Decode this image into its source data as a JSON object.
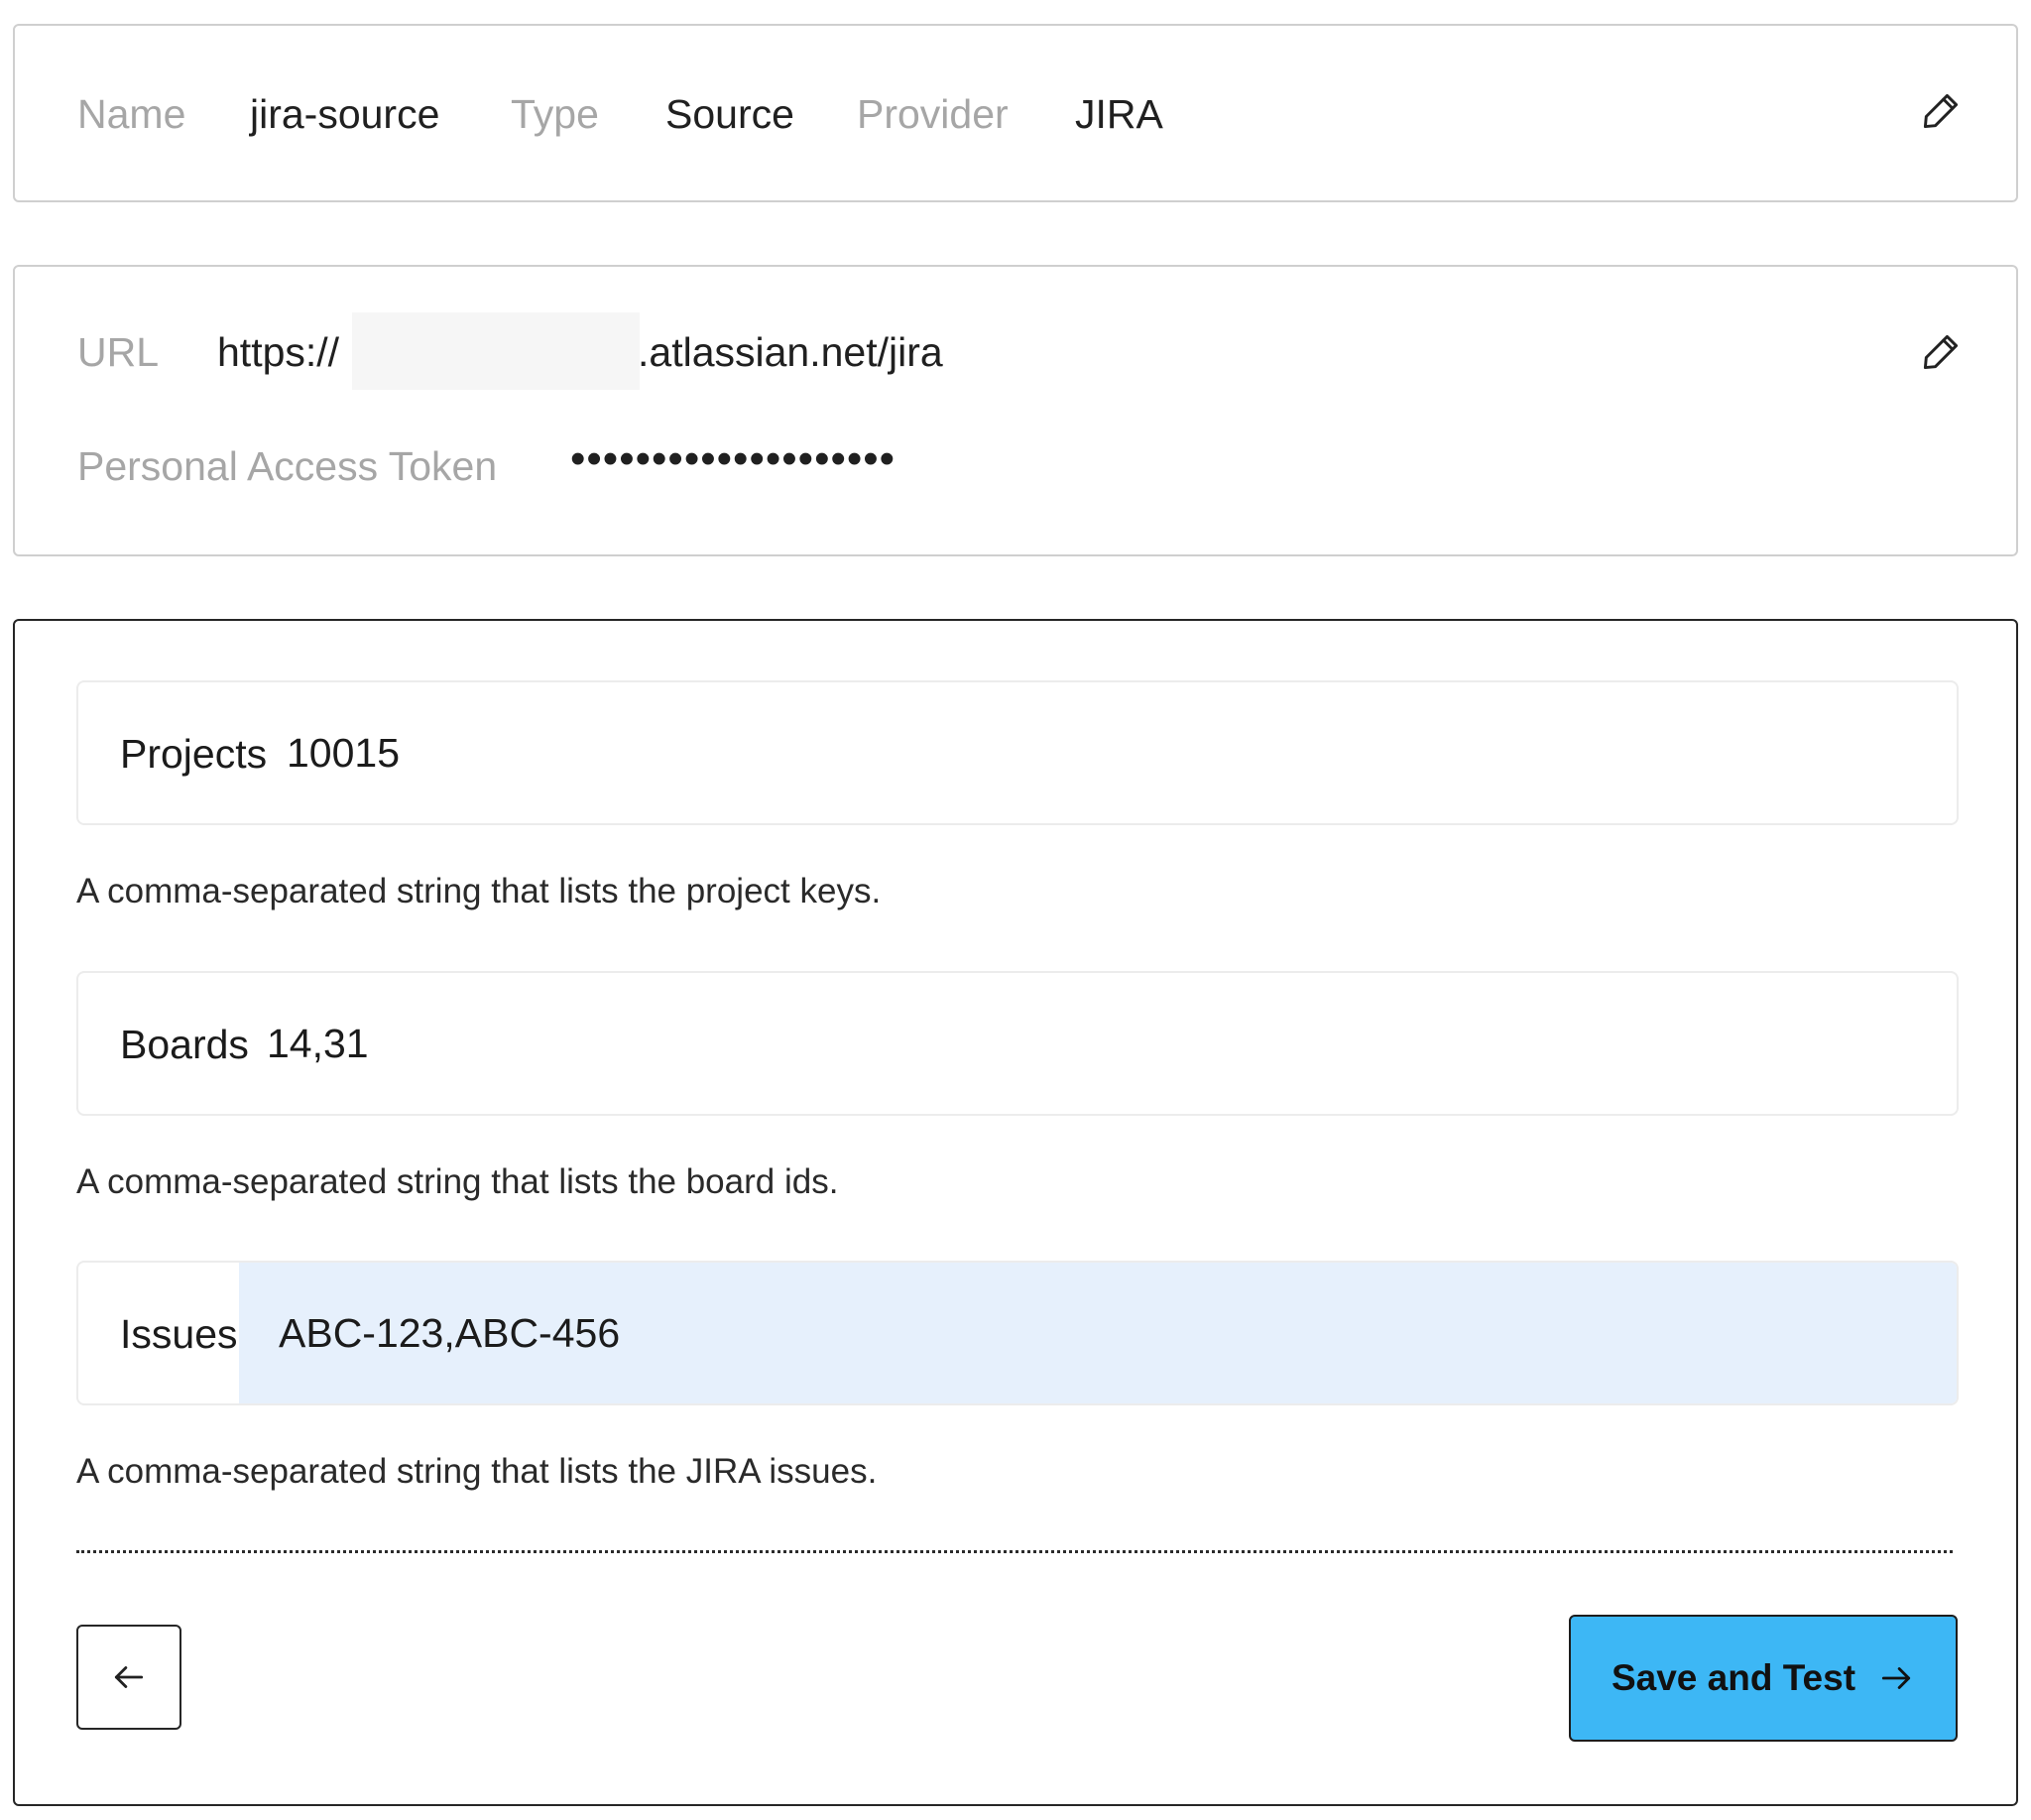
{
  "summary": {
    "name_label": "Name",
    "name_value": "jira-source",
    "type_label": "Type",
    "type_value": "Source",
    "provider_label": "Provider",
    "provider_value": "JIRA",
    "edit_icon": "pencil-icon"
  },
  "credentials": {
    "url_label": "URL",
    "url_prefix": "https://",
    "url_suffix": ".atlassian.net/jira",
    "token_label": "Personal Access Token",
    "token_value": "••••••••••••••••••••",
    "edit_icon": "pencil-icon"
  },
  "config": {
    "projects": {
      "label": "Projects",
      "value": "10015",
      "help": "A comma-separated string that lists the project keys."
    },
    "boards": {
      "label": "Boards",
      "value": "14,31",
      "help": "A comma-separated string that lists the board ids."
    },
    "issues": {
      "label": "Issues",
      "value": "ABC-123,ABC-456",
      "help": "A comma-separated string that lists the JIRA issues."
    },
    "back_icon": "arrow-left-icon",
    "save_label": "Save and Test",
    "save_icon": "arrow-right-icon"
  },
  "colors": {
    "accent_button": "#3db7f5",
    "focused_input": "#e6f0fc",
    "label_muted": "#a6a6a6"
  }
}
